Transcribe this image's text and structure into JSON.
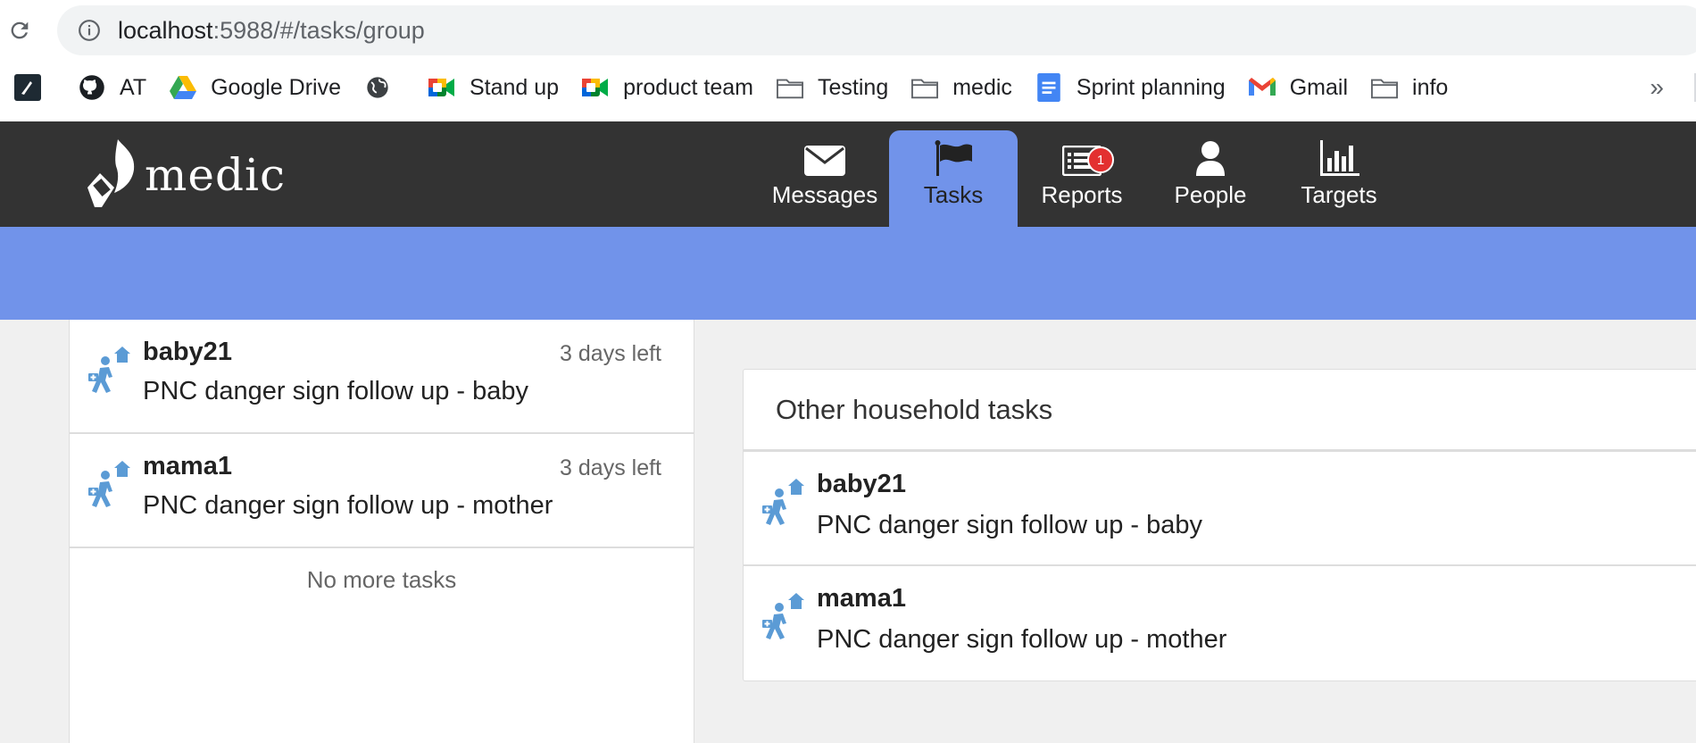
{
  "browser": {
    "url_host": "localhost",
    "url_path": ":5988/#/tasks/group",
    "bookmarks": [
      {
        "label": "",
        "icon": "medic-logo-icon"
      },
      {
        "label": "AT",
        "icon": "github-icon"
      },
      {
        "label": "Google Drive",
        "icon": "google-drive-icon"
      },
      {
        "label": "",
        "icon": "globe-icon"
      },
      {
        "label": "Stand up",
        "icon": "google-meet-icon"
      },
      {
        "label": "product team",
        "icon": "google-meet-icon"
      },
      {
        "label": "Testing",
        "icon": "folder-icon"
      },
      {
        "label": "medic",
        "icon": "folder-icon"
      },
      {
        "label": "Sprint planning",
        "icon": "google-docs-icon"
      },
      {
        "label": "Gmail",
        "icon": "gmail-icon"
      },
      {
        "label": "info",
        "icon": "folder-icon"
      }
    ],
    "more_label": "»"
  },
  "app": {
    "logo_text": "medic",
    "nav": [
      {
        "label": "Messages",
        "icon": "envelope-icon",
        "active": false
      },
      {
        "label": "Tasks",
        "icon": "flag-icon",
        "active": true
      },
      {
        "label": "Reports",
        "icon": "reports-icon",
        "active": false,
        "badge": "1"
      },
      {
        "label": "People",
        "icon": "person-icon",
        "active": false
      },
      {
        "label": "Targets",
        "icon": "bar-chart-icon",
        "active": false
      }
    ],
    "colors": {
      "header": "#333333",
      "accent": "#7193ea",
      "badge": "#e33030",
      "task_icon": "#5b9bd5"
    }
  },
  "task_list": {
    "items": [
      {
        "name": "baby21",
        "due": "3 days left",
        "title": "PNC danger sign follow up - baby",
        "icon": "home-visit-icon"
      },
      {
        "name": "mama1",
        "due": "3 days left",
        "title": "PNC danger sign follow up - mother",
        "icon": "home-visit-icon"
      }
    ],
    "footer": "No more tasks"
  },
  "household_panel": {
    "heading": "Other household tasks",
    "items": [
      {
        "name": "baby21",
        "title": "PNC danger sign follow up - baby",
        "icon": "home-visit-icon"
      },
      {
        "name": "mama1",
        "title": "PNC danger sign follow up - mother",
        "icon": "home-visit-icon"
      }
    ]
  }
}
